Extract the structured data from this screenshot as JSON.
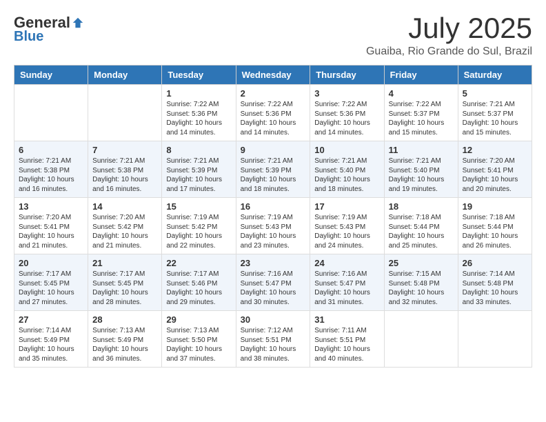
{
  "logo": {
    "general": "General",
    "blue": "Blue"
  },
  "title": {
    "month_year": "July 2025",
    "location": "Guaiba, Rio Grande do Sul, Brazil"
  },
  "days_of_week": [
    "Sunday",
    "Monday",
    "Tuesday",
    "Wednesday",
    "Thursday",
    "Friday",
    "Saturday"
  ],
  "weeks": [
    [
      {
        "day": "",
        "sunrise": "",
        "sunset": "",
        "daylight": ""
      },
      {
        "day": "",
        "sunrise": "",
        "sunset": "",
        "daylight": ""
      },
      {
        "day": "1",
        "sunrise": "Sunrise: 7:22 AM",
        "sunset": "Sunset: 5:36 PM",
        "daylight": "Daylight: 10 hours and 14 minutes."
      },
      {
        "day": "2",
        "sunrise": "Sunrise: 7:22 AM",
        "sunset": "Sunset: 5:36 PM",
        "daylight": "Daylight: 10 hours and 14 minutes."
      },
      {
        "day": "3",
        "sunrise": "Sunrise: 7:22 AM",
        "sunset": "Sunset: 5:36 PM",
        "daylight": "Daylight: 10 hours and 14 minutes."
      },
      {
        "day": "4",
        "sunrise": "Sunrise: 7:22 AM",
        "sunset": "Sunset: 5:37 PM",
        "daylight": "Daylight: 10 hours and 15 minutes."
      },
      {
        "day": "5",
        "sunrise": "Sunrise: 7:21 AM",
        "sunset": "Sunset: 5:37 PM",
        "daylight": "Daylight: 10 hours and 15 minutes."
      }
    ],
    [
      {
        "day": "6",
        "sunrise": "Sunrise: 7:21 AM",
        "sunset": "Sunset: 5:38 PM",
        "daylight": "Daylight: 10 hours and 16 minutes."
      },
      {
        "day": "7",
        "sunrise": "Sunrise: 7:21 AM",
        "sunset": "Sunset: 5:38 PM",
        "daylight": "Daylight: 10 hours and 16 minutes."
      },
      {
        "day": "8",
        "sunrise": "Sunrise: 7:21 AM",
        "sunset": "Sunset: 5:39 PM",
        "daylight": "Daylight: 10 hours and 17 minutes."
      },
      {
        "day": "9",
        "sunrise": "Sunrise: 7:21 AM",
        "sunset": "Sunset: 5:39 PM",
        "daylight": "Daylight: 10 hours and 18 minutes."
      },
      {
        "day": "10",
        "sunrise": "Sunrise: 7:21 AM",
        "sunset": "Sunset: 5:40 PM",
        "daylight": "Daylight: 10 hours and 18 minutes."
      },
      {
        "day": "11",
        "sunrise": "Sunrise: 7:21 AM",
        "sunset": "Sunset: 5:40 PM",
        "daylight": "Daylight: 10 hours and 19 minutes."
      },
      {
        "day": "12",
        "sunrise": "Sunrise: 7:20 AM",
        "sunset": "Sunset: 5:41 PM",
        "daylight": "Daylight: 10 hours and 20 minutes."
      }
    ],
    [
      {
        "day": "13",
        "sunrise": "Sunrise: 7:20 AM",
        "sunset": "Sunset: 5:41 PM",
        "daylight": "Daylight: 10 hours and 21 minutes."
      },
      {
        "day": "14",
        "sunrise": "Sunrise: 7:20 AM",
        "sunset": "Sunset: 5:42 PM",
        "daylight": "Daylight: 10 hours and 21 minutes."
      },
      {
        "day": "15",
        "sunrise": "Sunrise: 7:19 AM",
        "sunset": "Sunset: 5:42 PM",
        "daylight": "Daylight: 10 hours and 22 minutes."
      },
      {
        "day": "16",
        "sunrise": "Sunrise: 7:19 AM",
        "sunset": "Sunset: 5:43 PM",
        "daylight": "Daylight: 10 hours and 23 minutes."
      },
      {
        "day": "17",
        "sunrise": "Sunrise: 7:19 AM",
        "sunset": "Sunset: 5:43 PM",
        "daylight": "Daylight: 10 hours and 24 minutes."
      },
      {
        "day": "18",
        "sunrise": "Sunrise: 7:18 AM",
        "sunset": "Sunset: 5:44 PM",
        "daylight": "Daylight: 10 hours and 25 minutes."
      },
      {
        "day": "19",
        "sunrise": "Sunrise: 7:18 AM",
        "sunset": "Sunset: 5:44 PM",
        "daylight": "Daylight: 10 hours and 26 minutes."
      }
    ],
    [
      {
        "day": "20",
        "sunrise": "Sunrise: 7:17 AM",
        "sunset": "Sunset: 5:45 PM",
        "daylight": "Daylight: 10 hours and 27 minutes."
      },
      {
        "day": "21",
        "sunrise": "Sunrise: 7:17 AM",
        "sunset": "Sunset: 5:45 PM",
        "daylight": "Daylight: 10 hours and 28 minutes."
      },
      {
        "day": "22",
        "sunrise": "Sunrise: 7:17 AM",
        "sunset": "Sunset: 5:46 PM",
        "daylight": "Daylight: 10 hours and 29 minutes."
      },
      {
        "day": "23",
        "sunrise": "Sunrise: 7:16 AM",
        "sunset": "Sunset: 5:47 PM",
        "daylight": "Daylight: 10 hours and 30 minutes."
      },
      {
        "day": "24",
        "sunrise": "Sunrise: 7:16 AM",
        "sunset": "Sunset: 5:47 PM",
        "daylight": "Daylight: 10 hours and 31 minutes."
      },
      {
        "day": "25",
        "sunrise": "Sunrise: 7:15 AM",
        "sunset": "Sunset: 5:48 PM",
        "daylight": "Daylight: 10 hours and 32 minutes."
      },
      {
        "day": "26",
        "sunrise": "Sunrise: 7:14 AM",
        "sunset": "Sunset: 5:48 PM",
        "daylight": "Daylight: 10 hours and 33 minutes."
      }
    ],
    [
      {
        "day": "27",
        "sunrise": "Sunrise: 7:14 AM",
        "sunset": "Sunset: 5:49 PM",
        "daylight": "Daylight: 10 hours and 35 minutes."
      },
      {
        "day": "28",
        "sunrise": "Sunrise: 7:13 AM",
        "sunset": "Sunset: 5:49 PM",
        "daylight": "Daylight: 10 hours and 36 minutes."
      },
      {
        "day": "29",
        "sunrise": "Sunrise: 7:13 AM",
        "sunset": "Sunset: 5:50 PM",
        "daylight": "Daylight: 10 hours and 37 minutes."
      },
      {
        "day": "30",
        "sunrise": "Sunrise: 7:12 AM",
        "sunset": "Sunset: 5:51 PM",
        "daylight": "Daylight: 10 hours and 38 minutes."
      },
      {
        "day": "31",
        "sunrise": "Sunrise: 7:11 AM",
        "sunset": "Sunset: 5:51 PM",
        "daylight": "Daylight: 10 hours and 40 minutes."
      },
      {
        "day": "",
        "sunrise": "",
        "sunset": "",
        "daylight": ""
      },
      {
        "day": "",
        "sunrise": "",
        "sunset": "",
        "daylight": ""
      }
    ]
  ]
}
